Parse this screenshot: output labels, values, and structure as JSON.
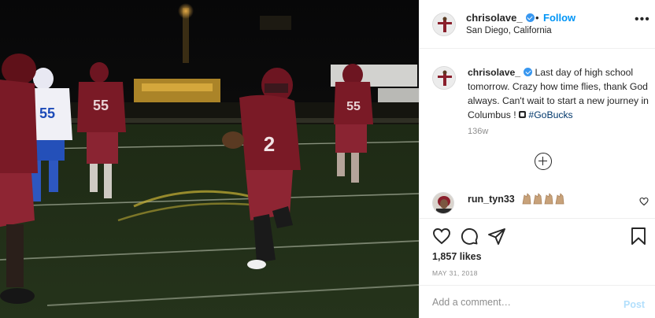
{
  "header": {
    "username": "chrisolave_",
    "separator": "•",
    "follow_label": "Follow",
    "location": "San Diego, California",
    "more_glyph": "•••"
  },
  "caption": {
    "username": "chrisolave_",
    "text": "Last day of high school tomorrow. Crazy how time flies, thank God always. Can't wait to start a new journey in Columbus ! ",
    "hashtag": "#GoBucks",
    "time": "136w"
  },
  "comment": {
    "username": "run_tyn33",
    "emoji_count": 4,
    "emoji_color": "#c8a27a"
  },
  "actions": {
    "icons": [
      "heart-icon",
      "comment-icon",
      "share-icon",
      "bookmark-icon"
    ],
    "likes": "1,857 likes",
    "date": "MAY 31, 2018"
  },
  "add_comment": {
    "placeholder": "Add a comment…",
    "post_label": "Post"
  },
  "photo": {
    "jersey_numbers": [
      "2",
      "55",
      "55",
      "55"
    ],
    "jersey_color": "#7a1a26",
    "opponent_color": "#1d4bb8"
  },
  "colors": {
    "accent": "#0095f6",
    "verified": "#3897f0",
    "post_disabled": "#b2dffc",
    "muted": "#8e8e8e"
  }
}
